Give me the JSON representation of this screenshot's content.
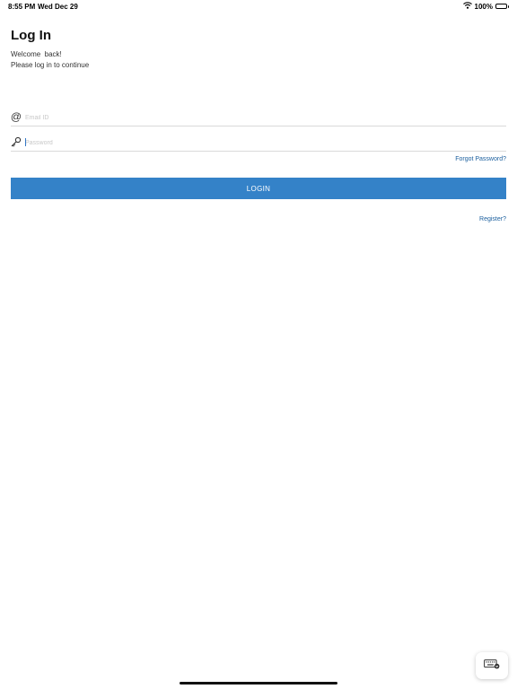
{
  "status_bar": {
    "time": "8:55 PM",
    "date": "Wed Dec 29",
    "battery_percent": "100%",
    "icons": [
      "wifi-icon",
      "battery-icon"
    ]
  },
  "header": {
    "title": "Log In",
    "welcome": "Welcome  back!",
    "subtitle": "Please log in to continue"
  },
  "form": {
    "email": {
      "placeholder": "Email ID",
      "value": "",
      "icon": "at-icon"
    },
    "password": {
      "placeholder": "Password",
      "value": "",
      "icon": "key-icon"
    },
    "forgot_label": "Forgot Password?",
    "login_label": "LOGIN",
    "register_label": "Register?"
  },
  "keyboard_toggle": {
    "icon": "keyboard-icon"
  },
  "colors": {
    "accent": "#3482c8",
    "link": "#1b5f9e",
    "placeholder": "#c8c8c8",
    "divider": "#d9d9d9"
  }
}
